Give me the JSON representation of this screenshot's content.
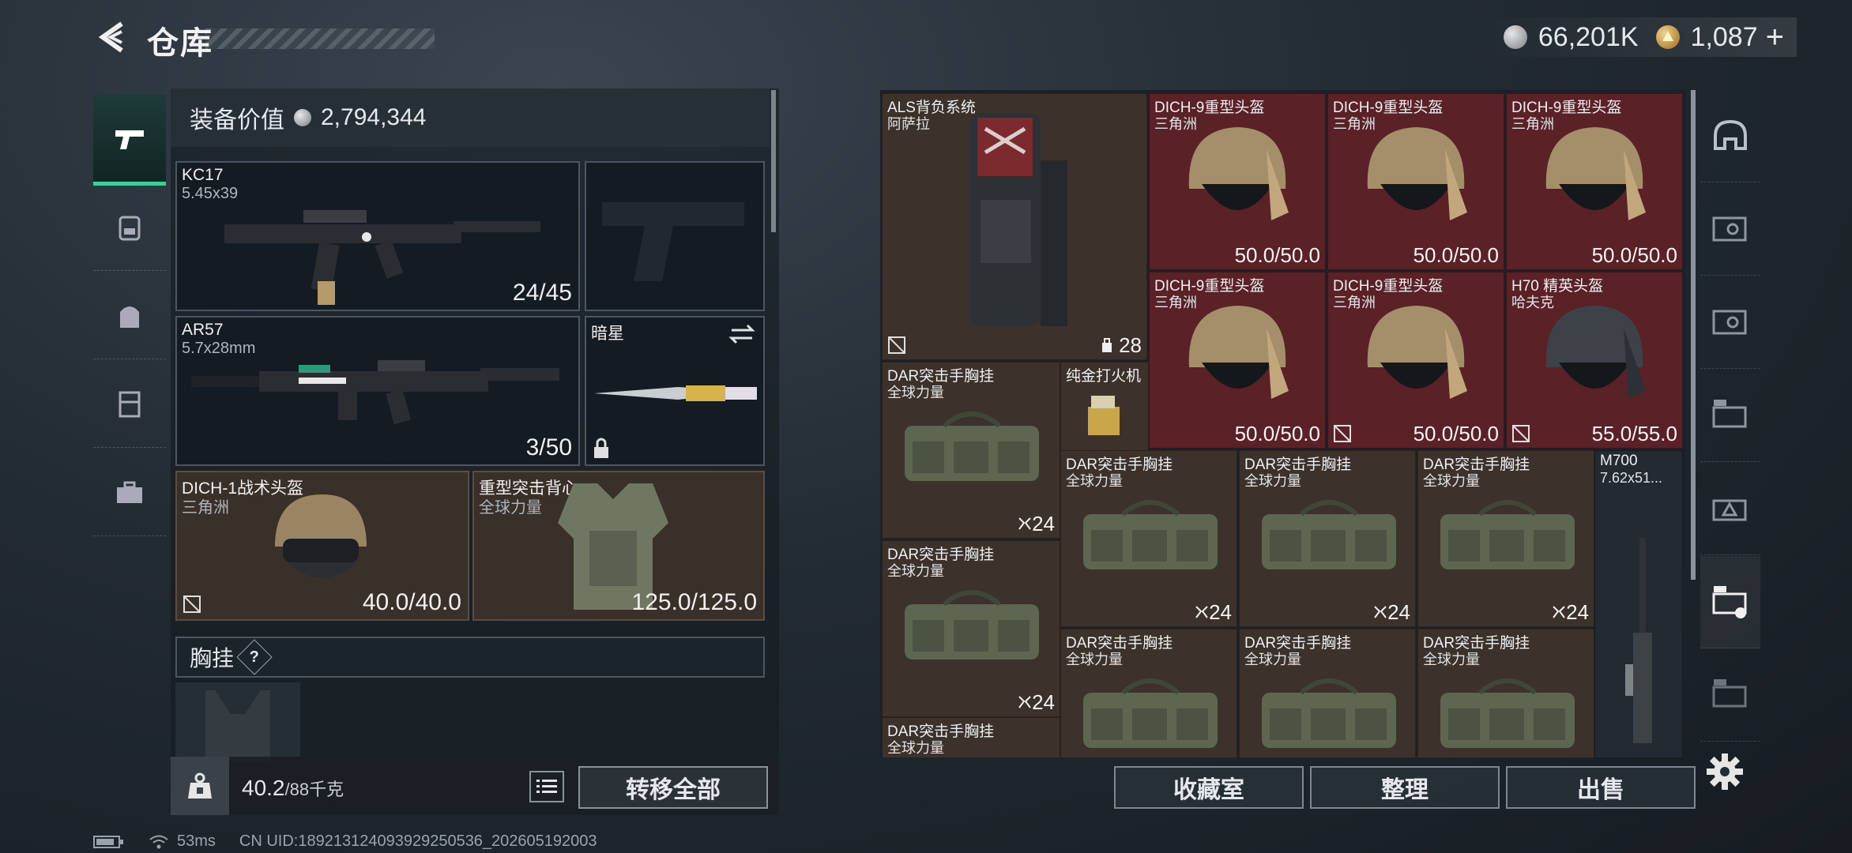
{
  "header": {
    "title": "仓库",
    "currency_silver": "66,201K",
    "currency_gold": "1,087",
    "add_label": "+"
  },
  "left_panel": {
    "equip_value_label": "装备价值",
    "equip_value": "2,794,344",
    "primary_weapon": {
      "name": "KC17",
      "caliber": "5.45x39",
      "ammo": "24/45"
    },
    "secondary_weapon": {
      "name": "AR57",
      "caliber": "5.7x28mm",
      "ammo": "3/50"
    },
    "melee": {
      "name": "暗星"
    },
    "helmet": {
      "name": "DICH-1战术头盔",
      "origin": "三角洲",
      "durability": "40.0/40.0"
    },
    "armor": {
      "name": "重型突击背心",
      "origin": "全球力量",
      "durability": "125.0/125.0"
    },
    "chest_rig_label": "胸挂",
    "chest_rig_help": "?",
    "weight": "40.2",
    "weight_max": "/88千克",
    "transfer_all": "转移全部"
  },
  "storage": {
    "backpack": {
      "name": "ALS背负系统",
      "origin": "阿萨拉",
      "count": "28"
    },
    "helmets": [
      {
        "name": "DICH-9重型头盔",
        "origin": "三角洲",
        "durability": "50.0/50.0"
      },
      {
        "name": "DICH-9重型头盔",
        "origin": "三角洲",
        "durability": "50.0/50.0"
      },
      {
        "name": "DICH-9重型头盔",
        "origin": "三角洲",
        "durability": "50.0/50.0"
      },
      {
        "name": "DICH-9重型头盔",
        "origin": "三角洲",
        "durability": "50.0/50.0"
      },
      {
        "name": "DICH-9重型头盔",
        "origin": "三角洲",
        "durability": "50.0/50.0"
      },
      {
        "name": "H70 精英头盔",
        "origin": "哈夫克",
        "durability": "55.0/55.0"
      }
    ],
    "lighter": {
      "name": "纯金打火机"
    },
    "rigs": [
      {
        "name": "DAR突击手胸挂",
        "origin": "全球力量",
        "count": "24"
      },
      {
        "name": "DAR突击手胸挂",
        "origin": "全球力量",
        "count": "24"
      },
      {
        "name": "DAR突击手胸挂",
        "origin": "全球力量",
        "count": "24"
      },
      {
        "name": "DAR突击手胸挂",
        "origin": "全球力量",
        "count": "24"
      },
      {
        "name": "DAR突击手胸挂",
        "origin": "全球力量",
        "count": "24"
      },
      {
        "name": "DAR突击手胸挂",
        "origin": "全球力量",
        "count": ""
      },
      {
        "name": "DAR突击手胸挂",
        "origin": "全球力量",
        "count": ""
      },
      {
        "name": "DAR突击手胸挂",
        "origin": "全球力量",
        "count": ""
      },
      {
        "name": "DAR突击手胸挂",
        "origin": "全球力量",
        "count": ""
      }
    ],
    "rifle": {
      "name": "M700",
      "caliber": "7.62x51..."
    }
  },
  "bottom_buttons": {
    "collection": "收藏室",
    "organize": "整理",
    "sell": "出售"
  },
  "status": {
    "ping": "53ms",
    "uid": "CN UID:189213124093929250536_202605192003"
  },
  "colors": {
    "accent": "#39d19a",
    "rare_red": "#5a2226",
    "common_brown": "#3c322b"
  },
  "icons": {
    "left_tabs": [
      "pistol-icon",
      "backpack-icon",
      "bag-icon",
      "chest-rig-icon",
      "toolbox-icon"
    ],
    "right_tabs": [
      "helmet-icon",
      "storage-ext-1-icon",
      "storage-ext-2-icon",
      "storage-ext-3-icon",
      "storage-ext-4-icon",
      "storage-ext-5-icon",
      "storage-ext-6-icon"
    ]
  }
}
